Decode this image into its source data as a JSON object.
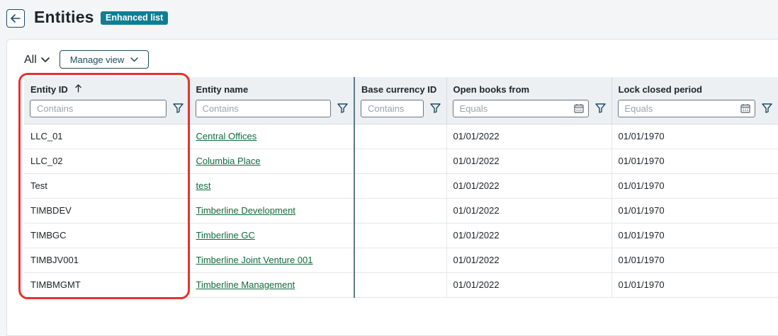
{
  "header": {
    "title": "Entities",
    "badge": "Enhanced list"
  },
  "toolbar": {
    "view_label": "All",
    "manage_view_label": "Manage view"
  },
  "columns": [
    {
      "label": "Entity ID",
      "placeholder": "Contains",
      "sorted": "ascending"
    },
    {
      "label": "Entity name",
      "placeholder": "Contains"
    },
    {
      "label": "Base currency ID",
      "placeholder": "Contains"
    },
    {
      "label": "Open books from",
      "placeholder": "Equals"
    },
    {
      "label": "Lock closed period",
      "placeholder": "Equals"
    }
  ],
  "rows": [
    {
      "entity_id": "LLC_01",
      "entity_name": "Central Offices",
      "base_currency": "",
      "open_books_from": "01/01/2022",
      "lock_closed_period": "01/01/1970"
    },
    {
      "entity_id": "LLC_02",
      "entity_name": "Columbia Place",
      "base_currency": "",
      "open_books_from": "01/01/2022",
      "lock_closed_period": "01/01/1970"
    },
    {
      "entity_id": "Test",
      "entity_name": "test",
      "base_currency": "",
      "open_books_from": "01/01/2022",
      "lock_closed_period": "01/01/1970"
    },
    {
      "entity_id": "TIMBDEV",
      "entity_name": "Timberline Development",
      "base_currency": "",
      "open_books_from": "01/01/2022",
      "lock_closed_period": "01/01/1970"
    },
    {
      "entity_id": "TIMBGC",
      "entity_name": "Timberline GC",
      "base_currency": "",
      "open_books_from": "01/01/2022",
      "lock_closed_period": "01/01/1970"
    },
    {
      "entity_id": "TIMBJV001",
      "entity_name": "Timberline Joint Venture 001",
      "base_currency": "",
      "open_books_from": "01/01/2022",
      "lock_closed_period": "01/01/1970"
    },
    {
      "entity_id": "TIMBMGMT",
      "entity_name": "Timberline Management",
      "base_currency": "",
      "open_books_from": "01/01/2022",
      "lock_closed_period": "01/01/1970"
    }
  ],
  "colors": {
    "accent": "#0f7d95",
    "link": "#0f6b3c",
    "highlight": "#e8312d"
  }
}
